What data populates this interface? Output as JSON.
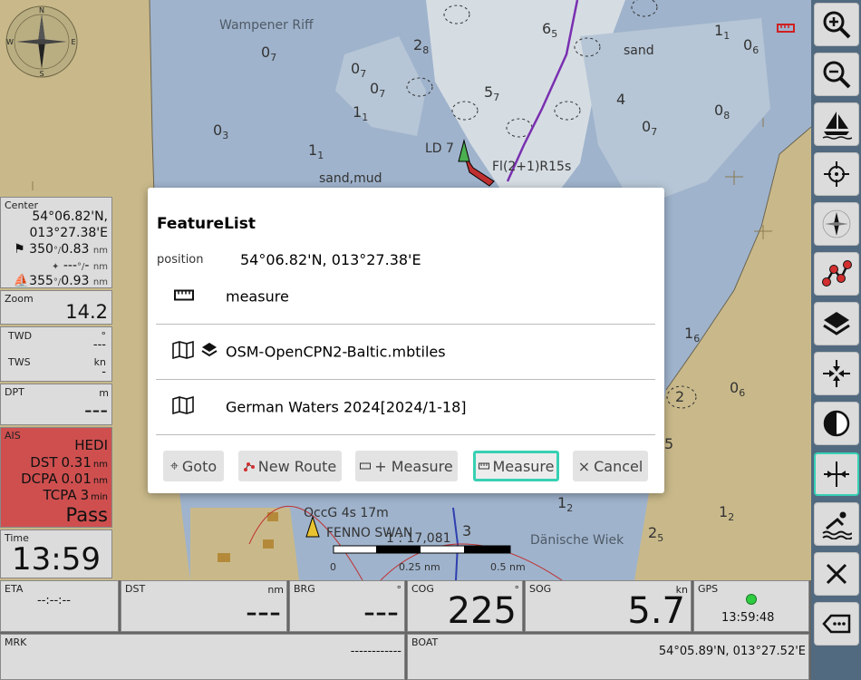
{
  "map": {
    "place_labels": [
      "Wampener Riff",
      "sand",
      "sand,mud",
      "LD 7",
      "Fl(2+1)R15s",
      "OccG 4s 17m",
      "FENNO SWAN",
      "Dänische Wiek"
    ],
    "depths": [
      {
        "v": "0",
        "s": "7"
      },
      {
        "v": "2",
        "s": "8"
      },
      {
        "v": "0",
        "s": "7"
      },
      {
        "v": "0",
        "s": "7"
      },
      {
        "v": "1",
        "s": "1"
      },
      {
        "v": "0",
        "s": "3"
      },
      {
        "v": "1",
        "s": "1"
      },
      {
        "v": "6",
        "s": "5"
      },
      {
        "v": "1",
        "s": "1"
      },
      {
        "v": "0",
        "s": "6"
      },
      {
        "v": "0",
        "s": "7"
      },
      {
        "v": "0",
        "s": "8"
      },
      {
        "v": "1",
        "s": "6"
      },
      {
        "v": "0",
        "s": "6"
      },
      {
        "v": "1",
        "s": "2"
      },
      {
        "v": "2",
        "s": ""
      },
      {
        "v": "1",
        "s": "2"
      },
      {
        "v": "2",
        "s": "5"
      },
      {
        "v": "5",
        "s": "7"
      },
      {
        "v": "4",
        "s": ""
      },
      {
        "v": "3",
        "s": ""
      },
      {
        "v": "5",
        "s": ""
      }
    ],
    "scale": {
      "ratio": "1 : 17,081",
      "ticks": [
        "0",
        "0.25 nm",
        "0.5 nm"
      ]
    },
    "compass_letters": [
      "N",
      "E",
      "S",
      "W"
    ]
  },
  "toolbar": {
    "buttons": [
      {
        "icon": "zoom-in-icon"
      },
      {
        "icon": "zoom-out-icon"
      },
      {
        "icon": "boat-icon"
      },
      {
        "icon": "crosshair-icon"
      },
      {
        "icon": "compass-north-icon"
      },
      {
        "icon": "route-icon"
      },
      {
        "icon": "layers-icon"
      },
      {
        "icon": "center-arrows-icon"
      },
      {
        "icon": "contrast-icon"
      },
      {
        "icon": "measure-center-icon",
        "active": true
      },
      {
        "icon": "anchor-watch-icon"
      },
      {
        "icon": "close-icon"
      },
      {
        "icon": "back-icon"
      }
    ]
  },
  "widgets": {
    "center": {
      "label": "Center",
      "lat": "54°06.82'N,",
      "lon": "013°27.38'E",
      "course": "350",
      "course_dist": "0.83",
      "wp": "---",
      "wp_dist": "-",
      "boat_course": "355",
      "boat_dist": "0.93",
      "deg_unit": "°/",
      "nm": "nm"
    },
    "zoom": {
      "label": "Zoom",
      "value": "14.2"
    },
    "wind": {
      "twd_label": "TWD",
      "twd_unit": "°",
      "twd_value": "---",
      "tws_label": "TWS",
      "tws_unit": "kn",
      "tws_value": "-"
    },
    "dpt": {
      "label": "DPT",
      "unit": "m",
      "value": "---"
    },
    "ais": {
      "label": "AIS",
      "name": "HEDI",
      "dst_label": "DST",
      "dst_value": "0.31",
      "dst_unit": "nm",
      "dcpa_label": "DCPA",
      "dcpa_value": "0.01",
      "dcpa_unit": "nm",
      "tcpa_label": "TCPA",
      "tcpa_value": "3",
      "tcpa_unit": "min",
      "status": "Pass"
    },
    "time": {
      "label": "Time",
      "value": "13:59"
    }
  },
  "bottom": {
    "eta": {
      "label": "ETA",
      "value": "--:--:--"
    },
    "dst": {
      "label": "DST",
      "unit": "nm",
      "value": "---"
    },
    "brg": {
      "label": "BRG",
      "unit": "°",
      "value": "---"
    },
    "cog": {
      "label": "COG",
      "unit": "°",
      "value": "225"
    },
    "sog": {
      "label": "SOG",
      "unit": "kn",
      "value": "5.7"
    },
    "gps": {
      "label": "GPS",
      "value": "13:59:48"
    },
    "mrk": {
      "label": "MRK",
      "value": "------------"
    },
    "boat": {
      "label": "BOAT",
      "value": "54°05.89'N, 013°27.52'E"
    }
  },
  "dialog": {
    "title": "FeatureList",
    "position_label": "position",
    "position_value": "54°06.82'N, 013°27.38'E",
    "features": [
      {
        "icon": "ruler-icon",
        "label": "measure"
      },
      {
        "icon": "map-icon",
        "label": "OSM-OpenCPN2-Baltic.mbtiles"
      },
      {
        "icon": "map-icon",
        "label": "German Waters 2024[2024/1-18]"
      }
    ],
    "buttons": {
      "goto": "Goto",
      "new_route": "New Route",
      "add_measure": "+ Measure",
      "measure": "Measure",
      "cancel": "Cancel"
    }
  },
  "colors": {
    "land": "#c9b98a",
    "shallow": "#9fb3cc",
    "deep": "#d5dde3",
    "toolbar": "#526a80",
    "accent": "#37d0b3",
    "ais": "#cf4f4f"
  }
}
